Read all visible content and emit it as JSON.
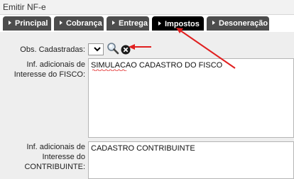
{
  "window": {
    "title": "Emitir NF-e"
  },
  "tabs": [
    {
      "label": "Principal"
    },
    {
      "label": "Cobrança"
    },
    {
      "label": "Entrega"
    },
    {
      "label": "Impostos",
      "active": true
    },
    {
      "label": "Desoneração"
    }
  ],
  "form": {
    "obs_label": "Obs. Cadastradas:",
    "obs_selected": "",
    "fisco_label_line1": "Inf. adicionais de",
    "fisco_label_line2": "Interesse do FISCO:",
    "fisco_value": "SIMULACAO CADASTRO DO FISCO",
    "contrib_label_line1": "Inf. adicionais de",
    "contrib_label_line2": "Interesse do",
    "contrib_label_line3": "CONTRIBUINTE:",
    "contrib_value": "CADASTRO CONTRIBUINTE"
  },
  "icons": {
    "search": "search-icon",
    "clear": "close-icon",
    "annotation": "red-arrow-icon"
  },
  "colors": {
    "tab_bg": "#4d4d4d",
    "tab_active_bg": "#000000",
    "annotation": "#e02020"
  }
}
